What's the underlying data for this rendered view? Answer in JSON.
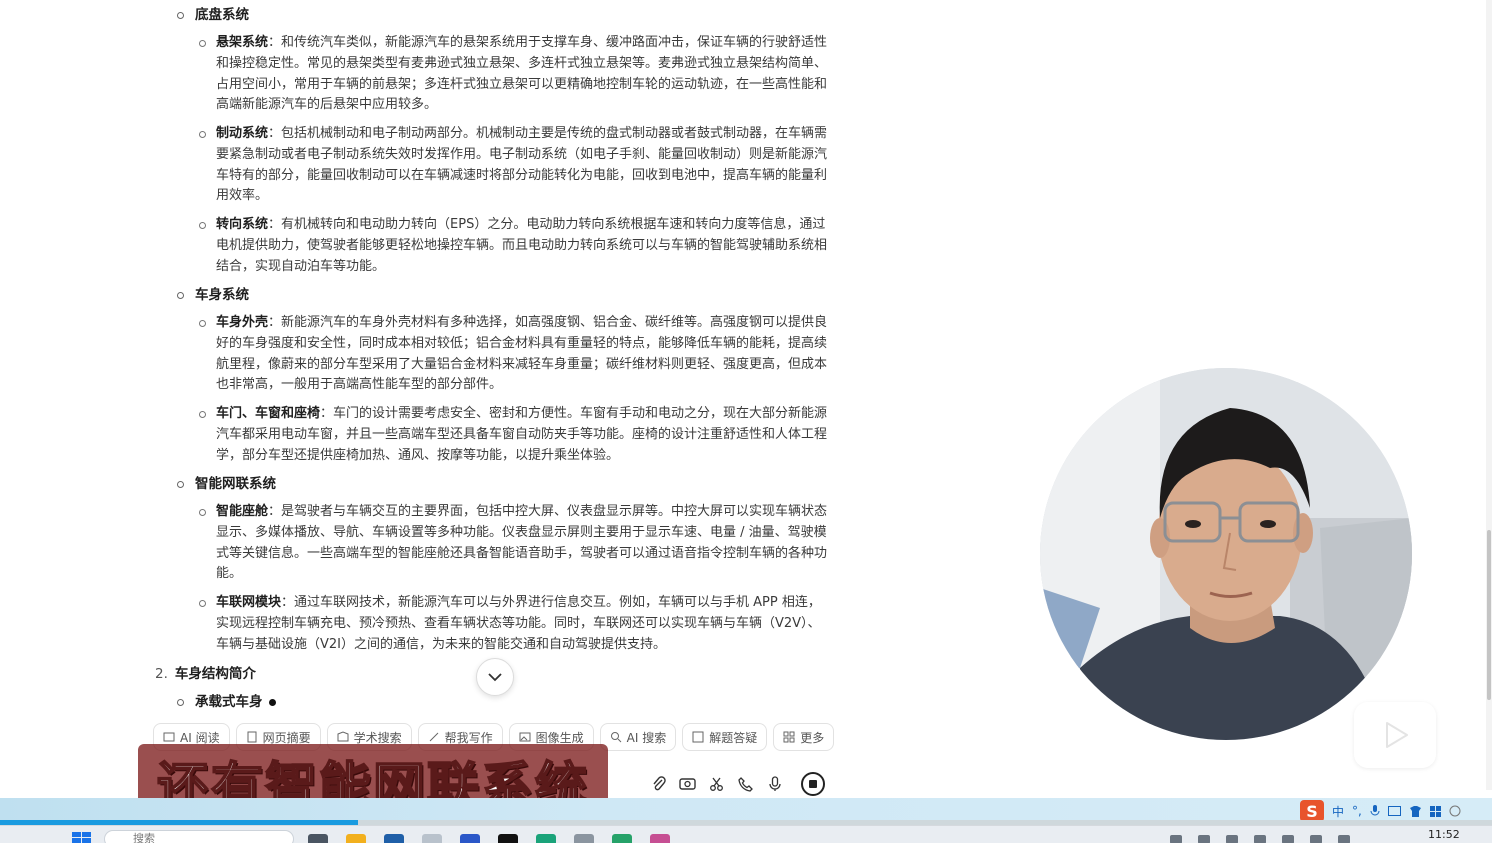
{
  "document": {
    "chassis": {
      "heading": "底盘系统",
      "items": [
        {
          "term": "悬架系统",
          "text": "：和传统汽车类似，新能源汽车的悬架系统用于支撑车身、缓冲路面冲击，保证车辆的行驶舒适性和操控稳定性。常见的悬架类型有麦弗逊式独立悬架、多连杆式独立悬架等。麦弗逊式独立悬架结构简单、占用空间小，常用于车辆的前悬架；多连杆式独立悬架可以更精确地控制车轮的运动轨迹，在一些高性能和高端新能源汽车的后悬架中应用较多。"
        },
        {
          "term": "制动系统",
          "text": "：包括机械制动和电子制动两部分。机械制动主要是传统的盘式制动器或者鼓式制动器，在车辆需要紧急制动或者电子制动系统失效时发挥作用。电子制动系统（如电子手刹、能量回收制动）则是新能源汽车特有的部分，能量回收制动可以在车辆减速时将部分动能转化为电能，回收到电池中，提高车辆的能量利用效率。"
        },
        {
          "term": "转向系统",
          "text": "：有机械转向和电动助力转向（EPS）之分。电动助力转向系统根据车速和转向力度等信息，通过电机提供助力，使驾驶者能够更轻松地操控车辆。而且电动助力转向系统可以与车辆的智能驾驶辅助系统相结合，实现自动泊车等功能。"
        }
      ]
    },
    "body": {
      "heading": "车身系统",
      "items": [
        {
          "term": "车身外壳",
          "text": "：新能源汽车的车身外壳材料有多种选择，如高强度钢、铝合金、碳纤维等。高强度钢可以提供良好的车身强度和安全性，同时成本相对较低；铝合金材料具有重量轻的特点，能够降低车辆的能耗，提高续航里程，像蔚来的部分车型采用了大量铝合金材料来减轻车身重量；碳纤维材料则更轻、强度更高，但成本也非常高，一般用于高端高性能车型的部分部件。"
        },
        {
          "term": "车门、车窗和座椅",
          "text": "：车门的设计需要考虑安全、密封和方便性。车窗有手动和电动之分，现在大部分新能源汽车都采用电动车窗，并且一些高端车型还具备车窗自动防夹手等功能。座椅的设计注重舒适性和人体工程学，部分车型还提供座椅加热、通风、按摩等功能，以提升乘坐体验。"
        }
      ]
    },
    "connected": {
      "heading": "智能网联系统",
      "items": [
        {
          "term": "智能座舱",
          "text": "：是驾驶者与车辆交互的主要界面，包括中控大屏、仪表盘显示屏等。中控大屏可以实现车辆状态显示、多媒体播放、导航、车辆设置等多种功能。仪表盘显示屏则主要用于显示车速、电量 / 油量、驾驶模式等关键信息。一些高端车型的智能座舱还具备智能语音助手，驾驶者可以通过语音指令控制车辆的各种功能。"
        },
        {
          "term": "车联网模块",
          "text": "：通过车联网技术，新能源汽车可以与外界进行信息交互。例如，车辆可以与手机 APP 相连，实现远程控制车辆充电、预冷预热、查看车辆状态等功能。同时，车联网还可以实现车辆与车辆（V2V）、车辆与基础设施（V2I）之间的通信，为未来的智能交通和自动驾驶提供支持。"
        }
      ]
    },
    "section2": {
      "number": "2.",
      "title": "车身结构简介"
    },
    "sub": {
      "title": "承载式车身"
    }
  },
  "toolbar": {
    "chips": [
      {
        "label": "AI 阅读",
        "icon": "ai-read-icon"
      },
      {
        "label": "网页摘要",
        "icon": "summary-icon"
      },
      {
        "label": "学术搜索",
        "icon": "academic-icon"
      },
      {
        "label": "帮我写作",
        "icon": "write-icon"
      },
      {
        "label": "图像生成",
        "icon": "image-gen-icon"
      },
      {
        "label": "AI 搜索",
        "icon": "ai-search-icon"
      },
      {
        "label": "解题答疑",
        "icon": "solve-icon"
      },
      {
        "label": "更多",
        "icon": "more-icon"
      }
    ]
  },
  "subtitle": "还有智能网联系统",
  "ime": {
    "mode": "中",
    "punct": "°,"
  },
  "taskbar": {
    "search_placeholder": "搜索",
    "clock": "11:52"
  },
  "colors": {
    "progress": "#1a9be0",
    "subtitle_bg": "#7a1414",
    "accent": "#1565c0"
  }
}
